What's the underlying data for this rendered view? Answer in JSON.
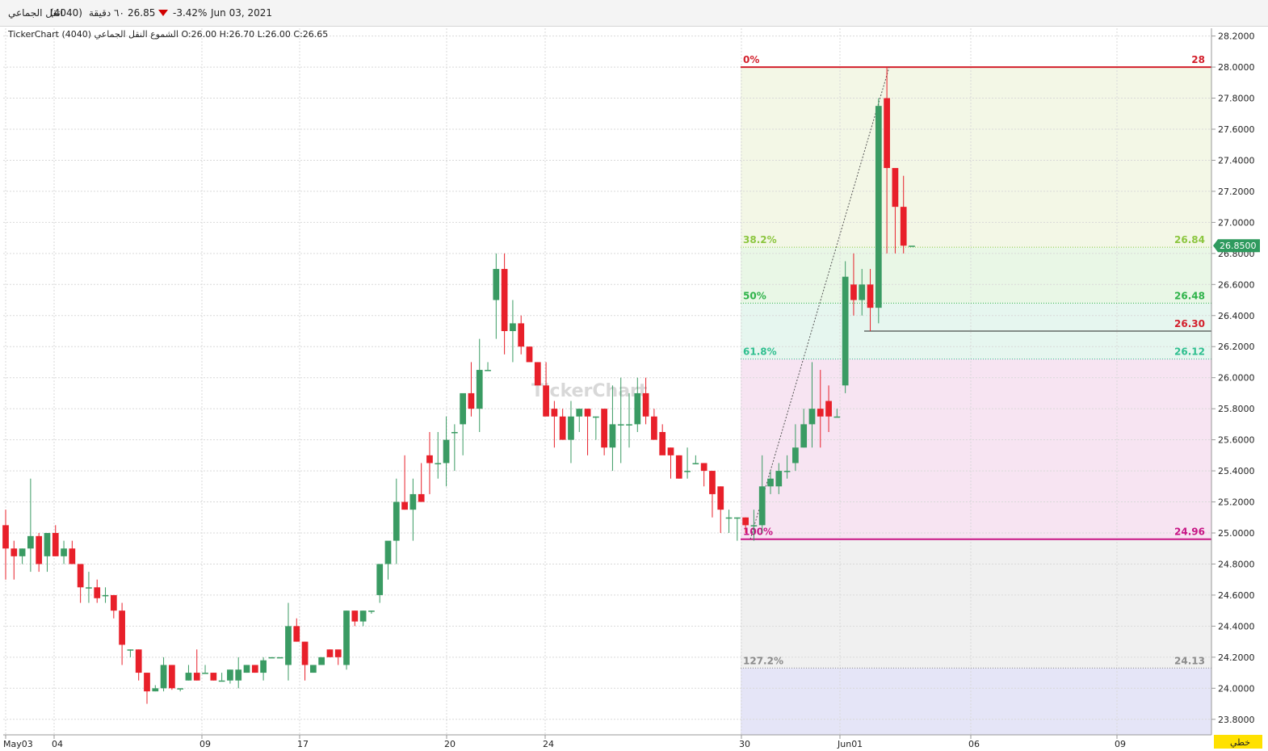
{
  "header": {
    "company": "انقل الجماعي",
    "symbol": "(4040)",
    "interval": "٦٠ دقيقة",
    "price": "26.85",
    "change": "-3.42%",
    "date": "Jun 03, 2021"
  },
  "chart_title": "TickerChart الشموع  النقل الجماعي (4040) O:26.00 H:26.70 L:26.00 C:26.65",
  "watermark": "TickerChart",
  "scale_button": "خطي",
  "colors": {
    "up": "#3a9b63",
    "down": "#e8202a",
    "grid": "#d9d9d9",
    "accent": "#2e9a5e"
  },
  "chart_data": {
    "type": "candlestick",
    "ylim": [
      23.7,
      28.25
    ],
    "yticks": [
      "28.2000",
      "28.0000",
      "27.8000",
      "27.6000",
      "27.4000",
      "27.2000",
      "27.0000",
      "26.8000",
      "26.6000",
      "26.4000",
      "26.2000",
      "26.0000",
      "25.8000",
      "25.6000",
      "25.4000",
      "25.2000",
      "25.0000",
      "24.8000",
      "24.6000",
      "24.4000",
      "24.2000",
      "24.0000",
      "23.8000"
    ],
    "xticks": [
      "May03",
      "04",
      "09",
      "17",
      "20",
      "24",
      "30",
      "Jun01",
      "06",
      "09"
    ],
    "last_price": "26.8500",
    "candles": [
      [
        25.05,
        25.15,
        24.7,
        24.9
      ],
      [
        24.9,
        24.95,
        24.7,
        24.85
      ],
      [
        24.85,
        24.9,
        24.8,
        24.9
      ],
      [
        24.9,
        25.35,
        24.75,
        24.98
      ],
      [
        24.98,
        25.0,
        24.75,
        24.8
      ],
      [
        24.85,
        25.0,
        24.75,
        25.0
      ],
      [
        25.0,
        25.05,
        24.85,
        24.85
      ],
      [
        24.85,
        24.95,
        24.8,
        24.9
      ],
      [
        24.9,
        24.95,
        24.8,
        24.8
      ],
      [
        24.8,
        24.8,
        24.55,
        24.65
      ],
      [
        24.65,
        24.75,
        24.55,
        24.65
      ],
      [
        24.65,
        24.7,
        24.55,
        24.58
      ],
      [
        24.6,
        24.65,
        24.55,
        24.6
      ],
      [
        24.6,
        24.6,
        24.45,
        24.5
      ],
      [
        24.5,
        24.55,
        24.15,
        24.28
      ],
      [
        24.25,
        24.25,
        24.2,
        24.25
      ],
      [
        24.25,
        24.25,
        24.05,
        24.1
      ],
      [
        24.1,
        24.1,
        23.9,
        23.98
      ],
      [
        23.98,
        24.02,
        23.98,
        24.0
      ],
      [
        24.0,
        24.2,
        23.98,
        24.15
      ],
      [
        24.15,
        24.15,
        23.99,
        24.0
      ],
      [
        24.0,
        24.0,
        23.98,
        24.0
      ],
      [
        24.05,
        24.15,
        24.05,
        24.1
      ],
      [
        24.1,
        24.25,
        24.05,
        24.05
      ],
      [
        24.1,
        24.15,
        24.1,
        24.1
      ],
      [
        24.1,
        24.1,
        24.05,
        24.05
      ],
      [
        24.05,
        24.1,
        24.05,
        24.05
      ],
      [
        24.05,
        24.12,
        24.03,
        24.12
      ],
      [
        24.05,
        24.2,
        24.0,
        24.12
      ],
      [
        24.1,
        24.15,
        24.1,
        24.15
      ],
      [
        24.15,
        24.15,
        24.1,
        24.1
      ],
      [
        24.1,
        24.2,
        24.05,
        24.18
      ],
      [
        24.2,
        24.2,
        24.2,
        24.2
      ],
      [
        24.2,
        24.2,
        24.2,
        24.2
      ],
      [
        24.15,
        24.55,
        24.05,
        24.4
      ],
      [
        24.4,
        24.45,
        24.3,
        24.3
      ],
      [
        24.3,
        24.3,
        24.05,
        24.15
      ],
      [
        24.1,
        24.15,
        24.1,
        24.15
      ],
      [
        24.15,
        24.2,
        24.15,
        24.2
      ],
      [
        24.25,
        24.25,
        24.2,
        24.2
      ],
      [
        24.25,
        24.2,
        24.15,
        24.2
      ],
      [
        24.15,
        24.5,
        24.12,
        24.5
      ],
      [
        24.5,
        24.5,
        24.4,
        24.43
      ],
      [
        24.43,
        24.5,
        24.4,
        24.5
      ],
      [
        24.5,
        24.5,
        24.48,
        24.5
      ],
      [
        24.6,
        24.8,
        24.55,
        24.8
      ],
      [
        24.8,
        24.85,
        24.7,
        24.95
      ],
      [
        24.95,
        25.35,
        24.8,
        25.2
      ],
      [
        25.2,
        25.5,
        25.15,
        25.15
      ],
      [
        25.15,
        25.35,
        24.95,
        25.25
      ],
      [
        25.25,
        25.45,
        25.2,
        25.2
      ],
      [
        25.5,
        25.65,
        25.25,
        25.45
      ],
      [
        25.45,
        25.65,
        25.35,
        25.45
      ],
      [
        25.45,
        25.75,
        25.3,
        25.6
      ],
      [
        25.65,
        25.7,
        25.4,
        25.65
      ],
      [
        25.7,
        25.8,
        25.5,
        25.9
      ],
      [
        25.9,
        26.1,
        25.75,
        25.8
      ],
      [
        25.8,
        26.25,
        25.65,
        26.05
      ],
      [
        26.05,
        26.1,
        26.05,
        26.05
      ],
      [
        26.5,
        26.8,
        26.25,
        26.7
      ],
      [
        26.7,
        26.8,
        26.15,
        26.3
      ],
      [
        26.3,
        26.5,
        26.1,
        26.35
      ],
      [
        26.35,
        26.4,
        26.15,
        26.2
      ],
      [
        26.2,
        26.2,
        26.15,
        26.1
      ],
      [
        26.1,
        26.1,
        25.95,
        25.95
      ],
      [
        25.95,
        26.1,
        25.85,
        25.75
      ],
      [
        25.8,
        25.85,
        25.55,
        25.75
      ],
      [
        25.75,
        25.8,
        25.6,
        25.6
      ],
      [
        25.6,
        25.85,
        25.45,
        25.75
      ],
      [
        25.75,
        25.8,
        25.65,
        25.8
      ],
      [
        25.8,
        25.8,
        25.5,
        25.75
      ],
      [
        25.75,
        25.75,
        25.6,
        25.75
      ],
      [
        25.8,
        25.8,
        25.5,
        25.55
      ],
      [
        25.55,
        25.95,
        25.4,
        25.7
      ],
      [
        25.7,
        26.0,
        25.45,
        25.7
      ],
      [
        25.7,
        25.9,
        25.55,
        25.7
      ],
      [
        25.7,
        26.0,
        25.65,
        25.9
      ],
      [
        25.9,
        26.0,
        25.7,
        25.75
      ],
      [
        25.75,
        25.8,
        25.6,
        25.6
      ],
      [
        25.65,
        25.7,
        25.55,
        25.5
      ],
      [
        25.55,
        25.55,
        25.35,
        25.5
      ],
      [
        25.5,
        25.5,
        25.35,
        25.35
      ],
      [
        25.4,
        25.55,
        25.35,
        25.4
      ],
      [
        25.45,
        25.5,
        25.45,
        25.45
      ],
      [
        25.45,
        25.45,
        25.3,
        25.4
      ],
      [
        25.4,
        25.4,
        25.1,
        25.25
      ],
      [
        25.3,
        25.3,
        25.0,
        25.15
      ],
      [
        25.1,
        25.15,
        25.0,
        25.1
      ],
      [
        25.1,
        25.1,
        24.95,
        25.1
      ],
      [
        25.1,
        25.1,
        25.0,
        25.05
      ],
      [
        25.05,
        25.15,
        24.95,
        25.05
      ],
      [
        25.05,
        25.5,
        25.0,
        25.3
      ],
      [
        25.3,
        25.4,
        25.25,
        25.35
      ],
      [
        25.3,
        25.45,
        25.25,
        25.4
      ],
      [
        25.4,
        25.5,
        25.35,
        25.4
      ],
      [
        25.45,
        25.7,
        25.4,
        25.55
      ],
      [
        25.55,
        25.8,
        25.55,
        25.7
      ],
      [
        25.7,
        26.1,
        25.55,
        25.8
      ],
      [
        25.8,
        26.05,
        25.55,
        25.75
      ],
      [
        25.85,
        25.95,
        25.65,
        25.75
      ],
      [
        25.75,
        25.8,
        25.75,
        25.75
      ],
      [
        25.95,
        26.75,
        25.9,
        26.65
      ],
      [
        26.6,
        26.8,
        26.4,
        26.5
      ],
      [
        26.5,
        26.7,
        26.4,
        26.6
      ],
      [
        26.6,
        26.7,
        26.3,
        26.45
      ],
      [
        26.45,
        27.8,
        26.35,
        27.75
      ],
      [
        27.8,
        28.0,
        26.8,
        27.35
      ],
      [
        27.35,
        27.1,
        26.8,
        27.1
      ],
      [
        27.1,
        27.3,
        26.8,
        26.85
      ],
      [
        26.85,
        26.85,
        26.85,
        26.85
      ]
    ],
    "fib": {
      "start_label": "0%",
      "levels": [
        {
          "label": "0%",
          "value": "28",
          "level": 28.0,
          "color": "#d31f2b"
        },
        {
          "label": "38.2%",
          "value": "26.84",
          "level": 26.84,
          "color": "#8cc63f"
        },
        {
          "label": "50%",
          "value": "26.48",
          "level": 26.48,
          "color": "#2fb34a"
        },
        {
          "label": "61.8%",
          "value": "26.12",
          "level": 26.12,
          "color": "#2fbf8f"
        },
        {
          "label": "100%",
          "value": "24.96",
          "level": 24.96,
          "color": "#c71585"
        },
        {
          "label": "127.2%",
          "value": "24.13",
          "level": 24.13,
          "color": "#8a8a8a"
        }
      ],
      "support_label": "26.30",
      "support_level": 26.3
    }
  }
}
